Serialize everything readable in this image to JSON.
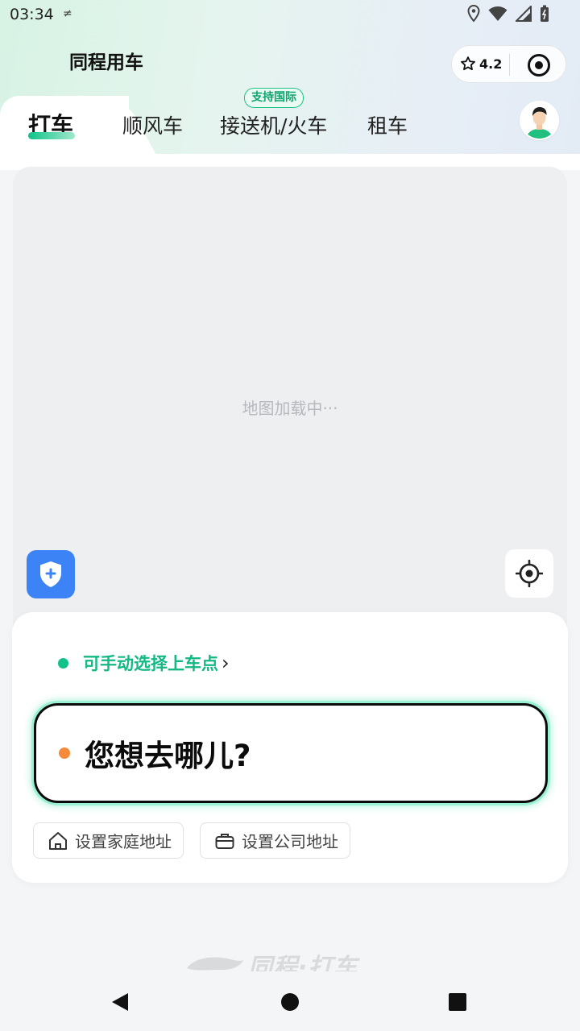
{
  "status_bar": {
    "time": "03:34",
    "small_icon": "≠"
  },
  "header": {
    "title": "同程用车",
    "rating": "4.2"
  },
  "tabs": [
    {
      "label": "打车",
      "active": true
    },
    {
      "label": "顺风车",
      "active": false
    },
    {
      "label": "接送机/火车",
      "active": false,
      "badge": "支持国际"
    },
    {
      "label": "租车",
      "active": false
    }
  ],
  "map": {
    "loading_text": "地图加载中···"
  },
  "booking": {
    "pickup_hint": "可手动选择上车点",
    "pickup_arrow": "›",
    "destination_placeholder": "您想去哪儿?",
    "home_address_label": "设置家庭地址",
    "company_address_label": "设置公司地址"
  },
  "watermark": "同程·打车",
  "colors": {
    "accent_green": "#10c28a",
    "orange_dot": "#f58a3a",
    "safety_blue": "#3c84f6"
  }
}
